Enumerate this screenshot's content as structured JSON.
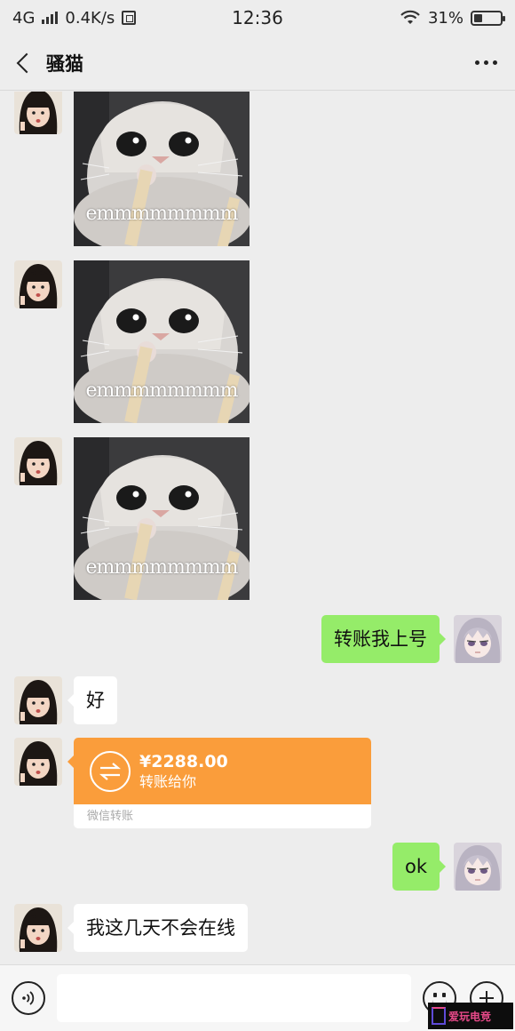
{
  "status_bar": {
    "network": "4G",
    "speed": "0.4K/s",
    "time": "12:36",
    "battery_percent": "31%",
    "battery_level": 0.31
  },
  "header": {
    "title": "骚猫"
  },
  "messages": [
    {
      "type": "sticker",
      "from": "other",
      "caption": "emmmmmmmm"
    },
    {
      "type": "sticker",
      "from": "other",
      "caption": "emmmmmmmm"
    },
    {
      "type": "sticker",
      "from": "other",
      "caption": "emmmmmmmm"
    },
    {
      "type": "text",
      "from": "me",
      "text": "转账我上号"
    },
    {
      "type": "text",
      "from": "other",
      "text": "好"
    },
    {
      "type": "transfer",
      "from": "other",
      "amount": "¥2288.00",
      "note": "转账给你",
      "footer": "微信转账"
    },
    {
      "type": "text",
      "from": "me",
      "text": "ok"
    },
    {
      "type": "text",
      "from": "other",
      "text": "我这几天不会在线"
    }
  ],
  "input_bar": {
    "placeholder": ""
  },
  "watermark": {
    "text": "爱玩电竞"
  },
  "colors": {
    "background": "#ededed",
    "outgoing_bubble": "#95ec69",
    "incoming_bubble": "#ffffff",
    "transfer": "#fa9d3b"
  },
  "icons": [
    "back-icon",
    "more-icon",
    "wifi-icon",
    "battery-icon",
    "voice-icon",
    "emoji-icon",
    "plus-icon",
    "transfer-icon"
  ]
}
